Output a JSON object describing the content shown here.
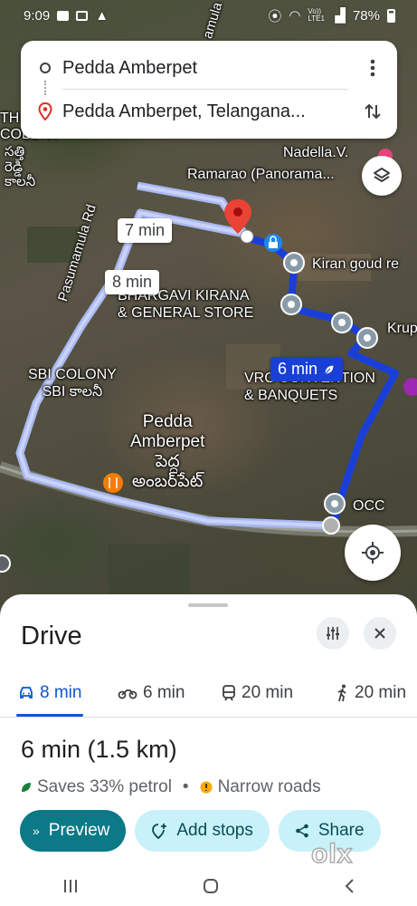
{
  "status_bar": {
    "time": "9:09",
    "network": "Vo)) LTE1",
    "battery": "78%"
  },
  "search": {
    "origin": "Pedda Amberpet",
    "destination": "Pedda Amberpet, Telangana..."
  },
  "map": {
    "labels": {
      "th_colony": "TH\nCOLONY",
      "telugu_colony": "సత్తి\nరెడ్డి\nకాలనీ",
      "road": "Pasumamula Rd",
      "road_top": "amula",
      "nadella": "Nadella.V.",
      "ramarao": "Ramarao (Panorama...",
      "kiran": "Kiran goud re",
      "bhargavi": "BHARGAVI KIRANA\n& GENERAL STORE",
      "krup": "Krup",
      "sbi": "SBI COLONY\nSBI కాలనీ",
      "vrc": "VRC CONVENTION\n& BANQUETS",
      "pedda": "Pedda\nAmberpet\nపెద్ద\nఅంబర్‌పేట్",
      "occ": "OCC"
    },
    "route_badges": {
      "alt1": "7 min",
      "alt2": "8 min",
      "primary": "6 min"
    }
  },
  "sheet": {
    "title": "Drive",
    "modes": [
      {
        "label": "8 min"
      },
      {
        "label": "6 min"
      },
      {
        "label": "20 min"
      },
      {
        "label": "20 min"
      }
    ],
    "summary_time": "6 min",
    "summary_distance": "(1.5 km)",
    "saves": "Saves 33% petrol",
    "separator": "•",
    "warning": "Narrow roads",
    "actions": {
      "preview": "Preview",
      "add_stops": "Add stops",
      "share": "Share"
    }
  },
  "watermark": "olx",
  "colors": {
    "primary_route": "#1a3fd9",
    "alt_route": "#a9b8f2",
    "accent": "#0b57d0",
    "preview_button": "#0b7a86"
  }
}
